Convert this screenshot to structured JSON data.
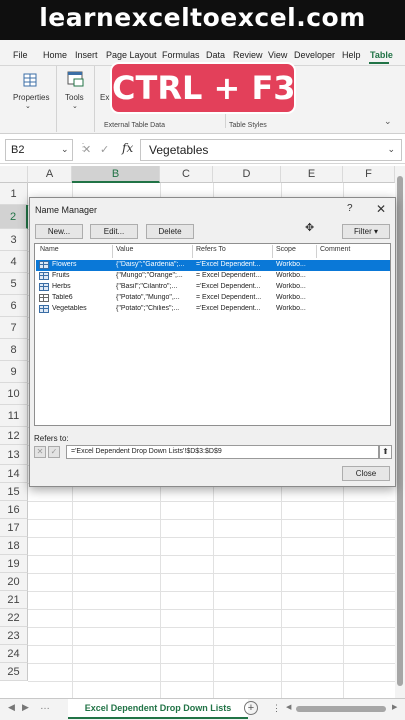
{
  "banner": {
    "text": "learnexceltoexcel.com"
  },
  "hotkey": {
    "text": "CTRL + F3"
  },
  "ribbon": {
    "tabs": [
      "File",
      "Home",
      "Insert",
      "Page Layout",
      "Formulas",
      "Data",
      "Review",
      "View",
      "Developer",
      "Help",
      "Table"
    ],
    "active_tab": "Table",
    "properties_label": "Properties",
    "tools_label": "Tools",
    "external_table_data_label": "External Table Data",
    "table_styles_label": "Table Styles",
    "partial_label": "Ex"
  },
  "formula_bar": {
    "name_box": "B2",
    "cancel_icon": "✕",
    "enter_icon": "✓",
    "fx": "fx",
    "value": "Vegetables"
  },
  "grid": {
    "columns": [
      "A",
      "B",
      "C",
      "D",
      "E",
      "F"
    ],
    "selected_column": "B",
    "rows": [
      "1",
      "2",
      "3",
      "4",
      "5",
      "6",
      "7",
      "8",
      "9",
      "10",
      "11",
      "12",
      "13",
      "14",
      "15",
      "16",
      "17",
      "18",
      "19",
      "20",
      "21",
      "22",
      "23",
      "24",
      "25"
    ],
    "selected_row": "2"
  },
  "dialog": {
    "title": "Name Manager",
    "help": "?",
    "close": "✕",
    "buttons": {
      "new": "New...",
      "edit": "Edit...",
      "delete": "Delete",
      "filter": "Filter ▾"
    },
    "columns": [
      "Name",
      "Value",
      "Refers To",
      "Scope",
      "Comment"
    ],
    "rows": [
      {
        "icon": "named-range-icon",
        "name": "Flowers",
        "value": "{\"Daisy\";\"Gardenia\";...",
        "refers_to": "='Excel Dependent...",
        "scope": "Workbo...",
        "comment": "",
        "selected": true
      },
      {
        "icon": "named-range-icon",
        "name": "Fruits",
        "value": "{\"Mungo\";\"Orange\";...",
        "refers_to": "= Excel Dependent...",
        "scope": "Workbo...",
        "comment": "",
        "selected": false
      },
      {
        "icon": "named-range-icon",
        "name": "Herbs",
        "value": "{\"Basil\";\"Cilantro\";...",
        "refers_to": "='Excel Dependent...",
        "scope": "Workbo...",
        "comment": "",
        "selected": false
      },
      {
        "icon": "table-icon",
        "name": "Table6",
        "value": "{\"Potato\",\"Mungo\",...",
        "refers_to": "= Excel Dependent...",
        "scope": "Workbo...",
        "comment": "",
        "selected": false
      },
      {
        "icon": "named-range-icon",
        "name": "Vegetables",
        "value": "{\"Potato\";\"Chilies\";...",
        "refers_to": "='Excel Dependent...",
        "scope": "Workbo...",
        "comment": "",
        "selected": false
      }
    ],
    "refers_to_label": "Refers to:",
    "refers_to_value": "='Excel Dependent Drop Down Lists'!$D$3:$D$9",
    "close_button": "Close"
  },
  "sheets": {
    "active": "Excel Dependent Drop Down Lists",
    "add": "+",
    "more": "⋮"
  },
  "colors": {
    "excel_green": "#217346",
    "hotkey_red": "#e3405a",
    "selection_blue": "#0a78d7"
  }
}
